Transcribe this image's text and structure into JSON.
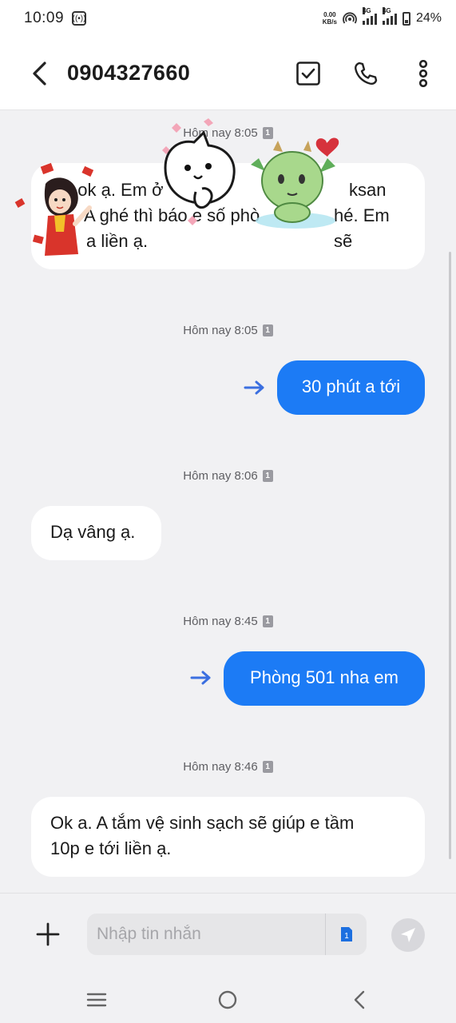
{
  "status_bar": {
    "time": "10:09",
    "net_speed_value": "0.00",
    "net_speed_unit": "KB/s",
    "network_1": "4G",
    "network_2": "4G",
    "battery": "24%"
  },
  "header": {
    "contact": "0904327660",
    "icons": [
      "back-icon",
      "select-checkbox-icon",
      "phone-icon",
      "more-vertical-icon"
    ]
  },
  "conversation": [
    {
      "timestamp": "Hôm nay 8:05",
      "direction": "in",
      "text_lines": [
        "Dạ ok ạ. Em ở",
        "A ghé thì báo e số phò",
        "a liền ạ."
      ],
      "text_tail_1": "ksan",
      "text_tail_2": "hé. Em sẽ"
    },
    {
      "timestamp": "Hôm nay 8:05",
      "direction": "out",
      "text": "30 phút a tới"
    },
    {
      "timestamp": "Hôm nay 8:06",
      "direction": "in",
      "text": "Dạ vâng ạ."
    },
    {
      "timestamp": "Hôm nay 8:45",
      "direction": "out",
      "text": "Phòng 501 nha em"
    },
    {
      "timestamp": "Hôm nay 8:46",
      "direction": "in",
      "text_lines": [
        "Ok a. A tắm vệ sinh sạch sẽ giúp e tầm",
        "10p e tới liền ạ."
      ]
    }
  ],
  "sim_badge": "1",
  "composer": {
    "placeholder": "Nhập tin nhắn",
    "value": "",
    "sim_label": "1"
  },
  "colors": {
    "outgoing_bubble": "#1c7bf5",
    "incoming_bubble": "#ffffff",
    "background": "#f1f1f3",
    "sent_arrow": "#3b6fe0"
  }
}
